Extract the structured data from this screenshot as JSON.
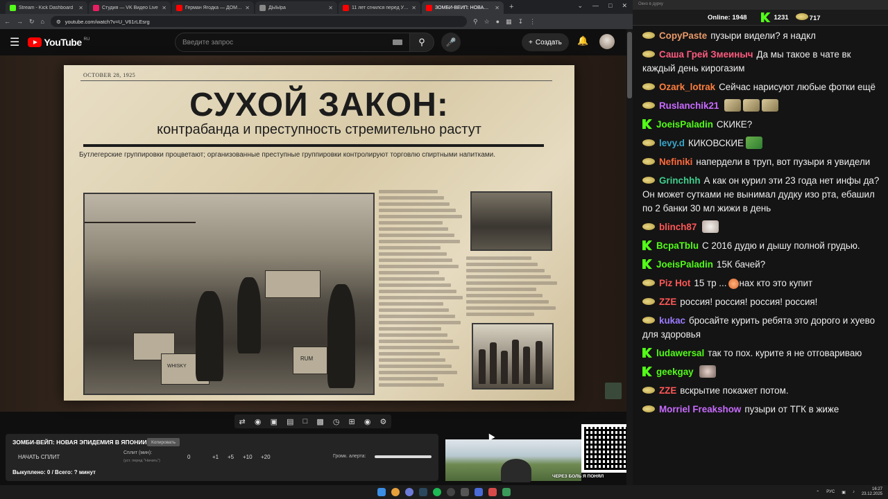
{
  "browser": {
    "tabs": [
      {
        "title": "Stream - Kick Dashboard",
        "color": "#53fc18",
        "active": false
      },
      {
        "title": "Студия — VK Видео Live",
        "color": "#e91e63",
        "active": false
      },
      {
        "title": "Герман Ягодка — ДОМ 2 и ан",
        "color": "#ff0000",
        "active": false
      },
      {
        "title": "ДЫЫра",
        "color": "#888888",
        "active": false
      },
      {
        "title": "11 лет сгнился перед Украин",
        "color": "#ff0000",
        "active": false
      },
      {
        "title": "ЗОМБИ-ВЕЙП: НОВАЯ ЭПИ",
        "color": "#ff0000",
        "active": true
      }
    ],
    "url": "youtube.com/watch?v=U_V61rLEsrg"
  },
  "youtube": {
    "logo": "YouTube",
    "region": "RU",
    "search_placeholder": "Введите запрос",
    "create_label": "Создать"
  },
  "video": {
    "newspaper": {
      "date": "OCTOBER 28, 1925",
      "headline": "СУХОЙ ЗАКОН:",
      "subheadline": "контрабанда и преступность стремительно растут",
      "deck": "Бутлегерские группировки процветают; организованные преступные группировки контролируют торговлю спиртными напитками.",
      "crate_label_1": "RUM",
      "crate_label_2": "WHISKY"
    }
  },
  "player_toolbar": {
    "icons": [
      "loop-icon",
      "broadcast-icon",
      "cast-icon",
      "film-icon",
      "frame-icon",
      "pip-icon",
      "speed-icon",
      "add-icon",
      "screenshot-icon",
      "settings-icon"
    ]
  },
  "widget": {
    "title": "ЗОМБИ-ВЕЙП: НОВАЯ ЭПИДЕМИЯ В ЯПОНИИ!",
    "copy_label": "Копировать",
    "start_split": "НАЧАТЬ СПЛИТ",
    "split_minutes": "Сплит (мин):",
    "split_hint": "(уст. перед \"Начать\")",
    "split_values": [
      "0",
      "+1",
      "+5",
      "+10",
      "+20"
    ],
    "alert_volume": "Громк. алерта:",
    "score": "Выкуплено: 0 / Всего: ? минут"
  },
  "cam": {
    "caption": "ЧЕРЕЗ БОЛЬ Я ПОНЯЛ"
  },
  "chat": {
    "window_title": "Окно в дурку",
    "online_label": "Online:",
    "online_count": "1948",
    "kick_count": "1231",
    "emote_count": "717",
    "messages": [
      {
        "badge": "e",
        "nick": "CopyPaste",
        "color": "#e89a6a",
        "text": "пузыри видели? я надкл"
      },
      {
        "badge": "e",
        "nick": "Саша Грей Змеиныч",
        "color": "#ff5b7f",
        "text": "Да мы такое в чате вк каждый день кирогазим"
      },
      {
        "badge": "e",
        "nick": "Ozark_lotrak",
        "color": "#ff7f3f",
        "text": "Сейчас нарисуют любые фотки ещё"
      },
      {
        "badge": "e",
        "nick": "Ruslanchik21",
        "color": "#c86bff",
        "text": "",
        "emotes": [
          "",
          "",
          ""
        ]
      },
      {
        "badge": "k",
        "nick": "JoeisPaladin",
        "color": "#53fc18",
        "text": "СКИКЕ?"
      },
      {
        "badge": "e",
        "nick": "levy.d",
        "color": "#3aa5c8",
        "text": "КИКОВСКИЕ",
        "emotes": [
          "g"
        ]
      },
      {
        "badge": "e",
        "nick": "Nefiniki",
        "color": "#ff6b3d",
        "text": "напердели в труп, вот пузыри я увидели"
      },
      {
        "badge": "e",
        "nick": "Grinchhh",
        "color": "#3fcf8e",
        "text": "А как он курил эти 23 года нет инфы да? Он может сутками не вынимал дудку изо рта, ебашил по 2 банки 30 мл жижи в день"
      },
      {
        "badge": "e",
        "nick": "blinch87",
        "color": "#ff5757",
        "text": "",
        "emotes": [
          "w"
        ]
      },
      {
        "badge": "k",
        "nick": "BcpaTblu",
        "color": "#53fc18",
        "text": "С 2016 дудю и дышу полной грудью."
      },
      {
        "badge": "k",
        "nick": "JoeisPaladin",
        "color": "#53fc18",
        "text": "15К бачей?"
      },
      {
        "badge": "e",
        "nick": "Piz Hot",
        "color": "#ff5757",
        "text": "15 тр ...",
        "emotes": [
          "f"
        ],
        "text2": "нах кто это купит"
      },
      {
        "badge": "e",
        "nick": "ZZE",
        "color": "#ff5757",
        "text": "россия! россия! россия! россия!"
      },
      {
        "badge": "e",
        "nick": "kukac",
        "color": "#9b7bff",
        "text": "бросайте курить ребята это дорого и хуево для здоровья"
      },
      {
        "badge": "k",
        "nick": "ludawersal",
        "color": "#53fc18",
        "text": "так то пох. курите я не отговариваю"
      },
      {
        "badge": "k",
        "nick": "geekgay",
        "color": "#53fc18",
        "text": "",
        "emotes": [
          "m"
        ]
      },
      {
        "badge": "e",
        "nick": "ZZE",
        "color": "#ff5757",
        "text": "вскрытие покажет потом."
      },
      {
        "badge": "e",
        "nick": "Morriel Freakshow",
        "color": "#c86bff",
        "text": "пузыри от ТГК в жиже"
      }
    ]
  },
  "taskbar": {
    "lang": "РУС",
    "time": "16:27",
    "date": "23.12.2025"
  }
}
